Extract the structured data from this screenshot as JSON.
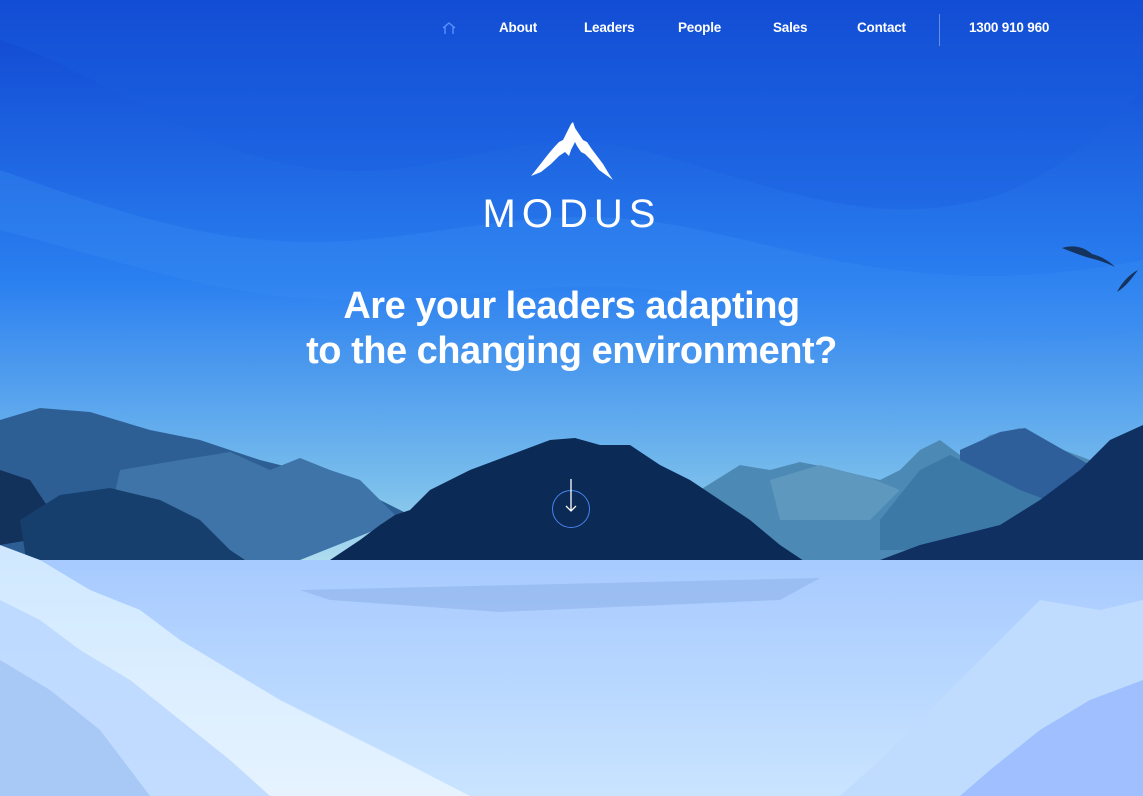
{
  "nav": {
    "home_icon": "home-icon",
    "items": [
      {
        "label": "About"
      },
      {
        "label": "Leaders"
      },
      {
        "label": "People"
      },
      {
        "label": "Sales"
      },
      {
        "label": "Contact"
      }
    ],
    "phone": "1300 910 960"
  },
  "logo": {
    "icon": "mountain-logo-icon",
    "wordmark": "MODUS"
  },
  "hero": {
    "headline_line1": "Are your leaders adapting",
    "headline_line2": "to the changing environment?"
  },
  "scroll_button": {
    "icon": "arrow-down-icon"
  },
  "colors": {
    "sky_top": "#1a55d8",
    "sky_bottom": "#a9d3ef",
    "mountain_dark": "#0b2a55",
    "lake": "#9fc6ff",
    "accent": "#4f8cff"
  }
}
